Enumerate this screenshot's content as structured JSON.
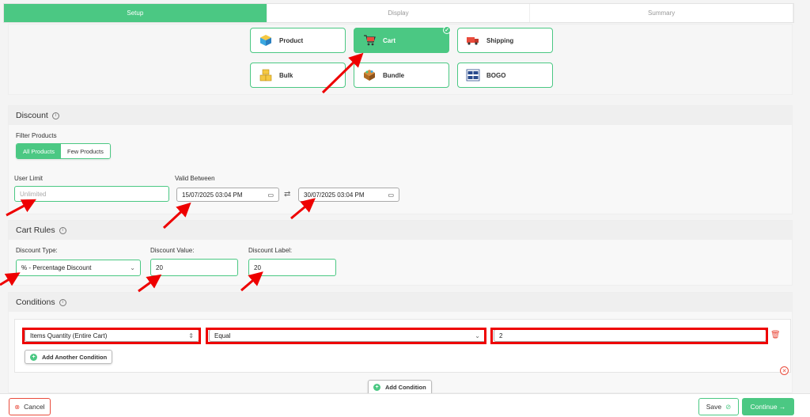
{
  "tabs": [
    "Setup",
    "Display",
    "Summary"
  ],
  "discount_types": [
    {
      "label": "Product",
      "icon": "box-icon"
    },
    {
      "label": "Cart",
      "icon": "cart-icon",
      "selected": true
    },
    {
      "label": "Shipping",
      "icon": "truck-icon"
    },
    {
      "label": "Bulk",
      "icon": "boxes-icon"
    },
    {
      "label": "Bundle",
      "icon": "bundle-icon"
    },
    {
      "label": "BOGO",
      "icon": "bogo-icon"
    }
  ],
  "discount": {
    "title": "Discount",
    "filter_label": "Filter Products",
    "filter_options": [
      "All Products",
      "Few Products"
    ],
    "user_limit_label": "User Limit",
    "user_limit_placeholder": "Unlimited",
    "valid_between_label": "Valid Between",
    "start_date": "15/07/2025 03:04 PM",
    "end_date": "30/07/2025 03:04 PM",
    "swap_symbol": "⇄"
  },
  "cart_rules": {
    "title": "Cart Rules",
    "type_label": "Discount Type:",
    "type_value": "% - Percentage Discount",
    "value_label": "Discount Value:",
    "value": "20",
    "label_label": "Discount Label:",
    "label_value": "20"
  },
  "conditions": {
    "title": "Conditions",
    "field": "Items Quantity (Entire Cart)",
    "operator": "Equal",
    "value": "2",
    "add_another": "Add Another Condition",
    "add_condition": "Add Condition"
  },
  "footer": {
    "cancel": "Cancel",
    "save": "Save",
    "continue": "Continue →"
  },
  "colors": {
    "accent": "#4bc883",
    "annotation": "#e00000"
  }
}
